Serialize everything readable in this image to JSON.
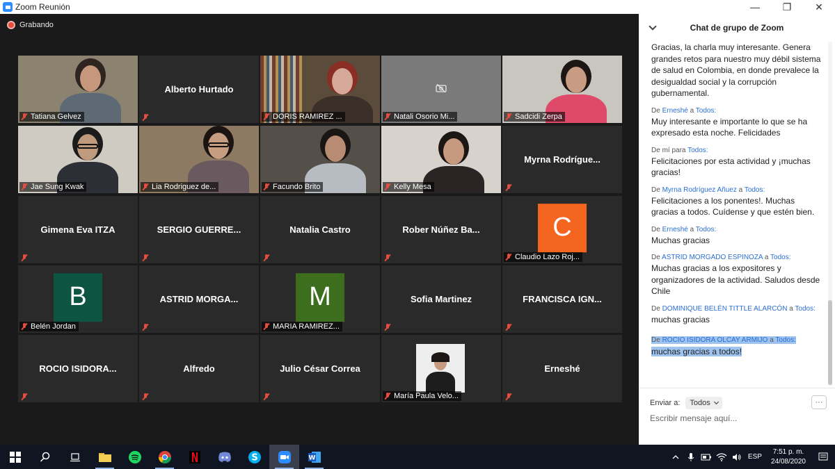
{
  "window": {
    "title": "Zoom Reunión",
    "minimize": "—",
    "maximize": "❐",
    "close": "✕"
  },
  "recording": {
    "label": "Grabando"
  },
  "tiles": [
    {
      "name": "Tatiana Gelvez",
      "big": "",
      "type": "photo"
    },
    {
      "name": "",
      "big": "Alberto Hurtado",
      "type": "name"
    },
    {
      "name": "DORIS RAMIREZ ...",
      "big": "",
      "type": "photo"
    },
    {
      "name": "Natali Osorio Mi...",
      "big": "",
      "type": "camoff"
    },
    {
      "name": "Sadcidi Zerpa",
      "big": "",
      "type": "photo"
    },
    {
      "name": "Jae Sung Kwak",
      "big": "",
      "type": "photo"
    },
    {
      "name": "Lia Rodriguez de...",
      "big": "",
      "type": "photo"
    },
    {
      "name": "Facundo Brito",
      "big": "",
      "type": "photo"
    },
    {
      "name": "Kelly Mesa",
      "big": "",
      "type": "photo"
    },
    {
      "name": "",
      "big": "Myrna  Rodrígue...",
      "type": "name"
    },
    {
      "name": "",
      "big": "Gimena Eva ITZA",
      "type": "name"
    },
    {
      "name": "",
      "big": "SERGIO  GUERRE...",
      "type": "name"
    },
    {
      "name": "",
      "big": "Natalia Castro",
      "type": "name"
    },
    {
      "name": "",
      "big": "Rober  Núñez  Ba...",
      "type": "name"
    },
    {
      "name": "Claudio Lazo Roj...",
      "big": "",
      "type": "avatar",
      "letter": "C",
      "color": "#f4661f"
    },
    {
      "name": "Belén Jordan",
      "big": "",
      "type": "avatar",
      "letter": "B",
      "color": "#0d5443"
    },
    {
      "name": "",
      "big": "ASTRID  MORGA...",
      "type": "name"
    },
    {
      "name": "MARIA RAMIREZ...",
      "big": "",
      "type": "avatar",
      "letter": "M",
      "color": "#3c6e1e"
    },
    {
      "name": "",
      "big": "Sofia Martinez",
      "type": "name"
    },
    {
      "name": "",
      "big": "FRANCISCA  IGN...",
      "type": "name"
    },
    {
      "name": "",
      "big": "ROCIO  ISIDORA...",
      "type": "name"
    },
    {
      "name": "",
      "big": "Alfredo",
      "type": "name"
    },
    {
      "name": "",
      "big": "Julio César Correa",
      "type": "name"
    },
    {
      "name": "María Paula Velo...",
      "big": "",
      "type": "photo"
    },
    {
      "name": "",
      "big": "Erneshé",
      "type": "name"
    }
  ],
  "chat": {
    "title": "Chat de grupo de Zoom",
    "messages": [
      {
        "from": "",
        "to": "",
        "text": "Gracias, la charla muy interesante. Genera grandes retos para nuestro muy débil sistema de salud en Colombia, en donde prevalece la desigualdad social y la corrupción gubernamental."
      },
      {
        "from": "Erneshé",
        "to": "Todos:",
        "text": "Muy interesante e importante lo que se ha expresado esta noche. Felicidades"
      },
      {
        "from": "mí",
        "to": "Todos:",
        "text": "Felicitaciones por esta actividad y ¡muchas gracias!",
        "self": true
      },
      {
        "from": "Myrna Rodríguez Añuez",
        "to": "Todos:",
        "text": "Felicitaciones a los ponentes!. Muchas gracias a todos. Cuídense y que estén bien."
      },
      {
        "from": "Erneshé",
        "to": "Todos:",
        "text": "Muchas gracias"
      },
      {
        "from": "ASTRID MORGADO ESPINOZA",
        "to": "Todos:",
        "text": "Muchas gracias a los expositores y organizadores de la actividad. Saludos desde Chile"
      },
      {
        "from": "DOMINIQUE BELÉN TITTLE ALARCÓN",
        "to": "Todos:",
        "text": "muchas gracias"
      },
      {
        "from": "ROCIO ISIDORA OLCAY ARMIJO",
        "to": "Todos:",
        "text": "muchas gracias a todos!",
        "selected": true
      }
    ],
    "words": {
      "de": "De",
      "para": "para",
      "a": "a"
    },
    "send_to_label": "Enviar a:",
    "send_to_value": "Todos",
    "more": "···",
    "input_placeholder": "Escribir mensaje aquí..."
  },
  "taskbar": {
    "time": "7:51 p. m.",
    "date": "24/08/2020",
    "lang": "ESP"
  }
}
